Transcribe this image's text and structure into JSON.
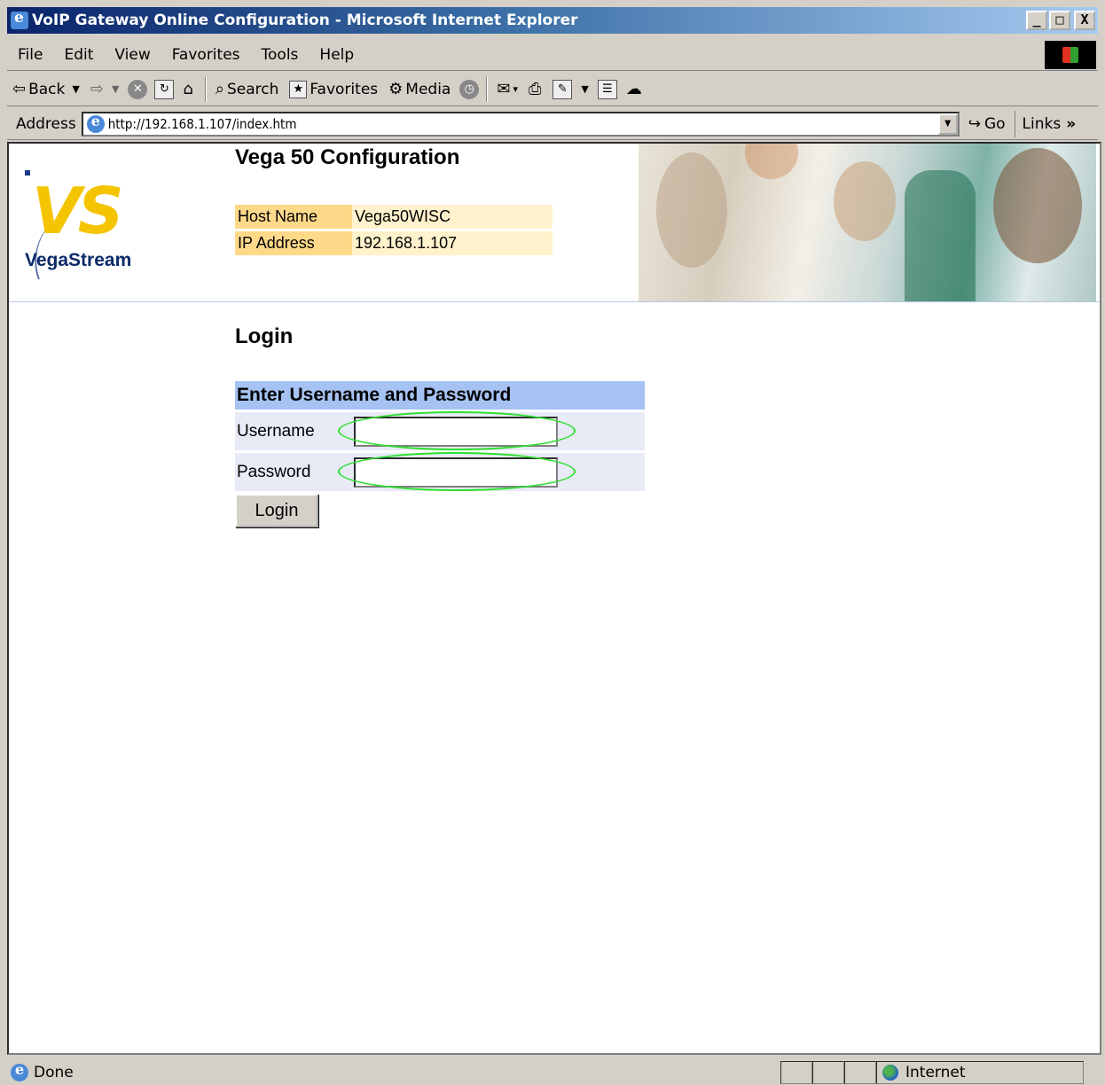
{
  "window": {
    "title": "VoIP Gateway Online Configuration - Microsoft Internet Explorer",
    "buttons": {
      "minimize": "_",
      "maximize": "□",
      "close": "X"
    }
  },
  "menu": {
    "items": [
      {
        "label": "File",
        "icon": ""
      },
      {
        "label": "Edit"
      },
      {
        "label": "View"
      },
      {
        "label": "Favorites"
      },
      {
        "label": "Tools"
      },
      {
        "label": "Help"
      }
    ]
  },
  "toolbar": {
    "back": "Back",
    "search": "Search",
    "favorites": "Favorites",
    "media": "Media",
    "icons": [
      "back-icon",
      "forward-icon",
      "stop-icon",
      "refresh-icon",
      "home-icon",
      "search-icon",
      "favorites-icon",
      "media-icon",
      "history-icon",
      "mail-icon",
      "print-icon",
      "edit-icon",
      "discuss-icon",
      "messenger-icon"
    ]
  },
  "address": {
    "label": "Address",
    "url": "http://192.168.1.107/index.htm",
    "go": "Go",
    "links": "Links"
  },
  "page": {
    "logo_text": "VegaStream",
    "logo_mark": "VS",
    "title": "Vega 50 Configuration",
    "info": [
      {
        "label": "Host Name",
        "value": "Vega50WISC"
      },
      {
        "label": "IP Address",
        "value": "192.168.1.107"
      }
    ],
    "login_title": "Login",
    "form": {
      "header": "Enter Username and Password",
      "username_label": "Username",
      "username_value": "",
      "password_label": "Password",
      "password_value": "",
      "submit": "Login"
    },
    "annotation_color": "#2ee02e"
  },
  "status": {
    "text": "Done",
    "zone": "Internet"
  }
}
